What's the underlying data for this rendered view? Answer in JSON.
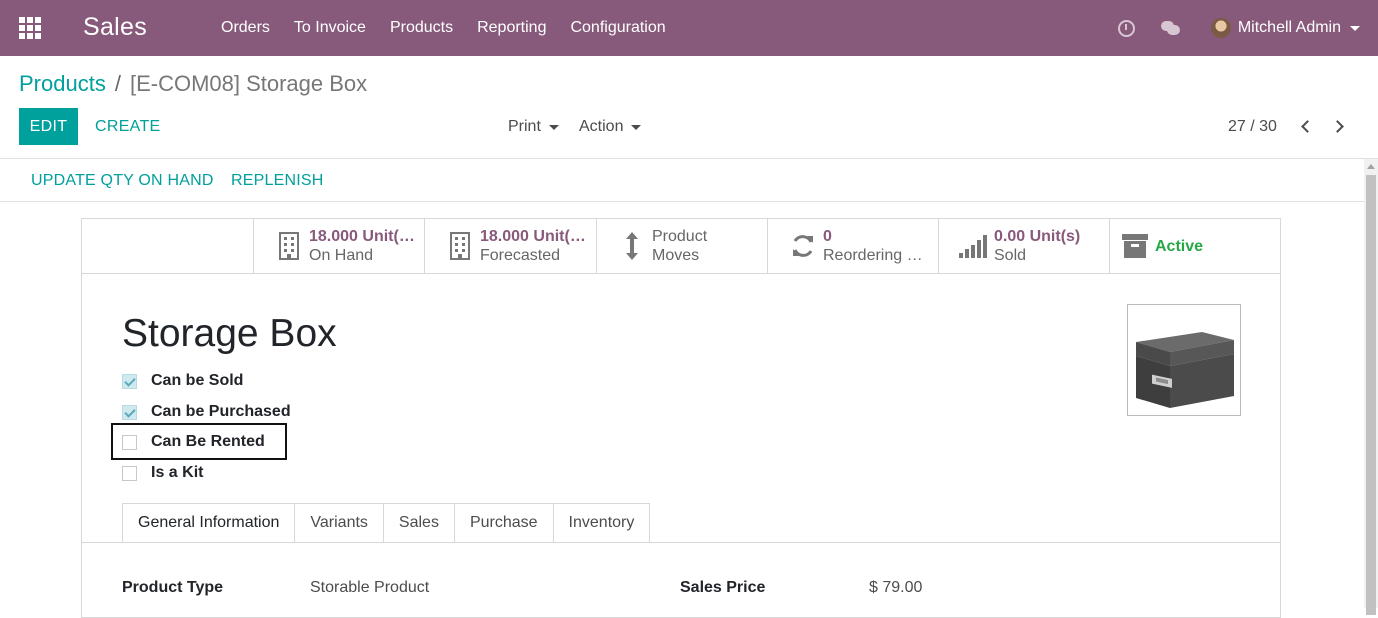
{
  "topbar": {
    "app_name": "Sales",
    "menu": [
      "Orders",
      "To Invoice",
      "Products",
      "Reporting",
      "Configuration"
    ],
    "user_name": "Mitchell Admin",
    "brand_color": "#875a7b"
  },
  "breadcrumb": {
    "parent": "Products",
    "separator": "/",
    "current": "[E-COM08] Storage Box"
  },
  "control_panel": {
    "edit_label": "EDIT",
    "create_label": "CREATE",
    "print_label": "Print",
    "action_label": "Action",
    "pager": "27 / 30"
  },
  "statusbar": {
    "update_qty_label": "UPDATE QTY ON HAND",
    "replenish_label": "REPLENISH"
  },
  "smart_buttons": [
    {
      "value": "18.000 Unit(…",
      "label": "On Hand",
      "icon": "building-icon"
    },
    {
      "value": "18.000 Unit(…",
      "label": "Forecasted",
      "icon": "building-icon"
    },
    {
      "value": "Product",
      "label": "Moves",
      "icon": "arrows-v-icon"
    },
    {
      "value": "0",
      "label": "Reordering …",
      "icon": "refresh-icon"
    },
    {
      "value": "0.00 Unit(s)",
      "label": "Sold",
      "icon": "signal-icon"
    },
    {
      "value": "Active",
      "label": "",
      "icon": "archive-icon"
    }
  ],
  "product": {
    "name": "Storage Box",
    "options": [
      {
        "label": "Can be Sold",
        "checked": true
      },
      {
        "label": "Can be Purchased",
        "checked": true
      },
      {
        "label": "Can Be Rented",
        "checked": false
      },
      {
        "label": "Is a Kit",
        "checked": false
      }
    ]
  },
  "tabs": [
    "General Information",
    "Variants",
    "Sales",
    "Purchase",
    "Inventory"
  ],
  "fields": {
    "product_type_label": "Product Type",
    "product_type_value": "Storable Product",
    "sales_price_label": "Sales Price",
    "sales_price_value": "$ 79.00"
  },
  "colors": {
    "accent": "#00a09d",
    "primary": "#875a7b",
    "active": "#28a745"
  }
}
